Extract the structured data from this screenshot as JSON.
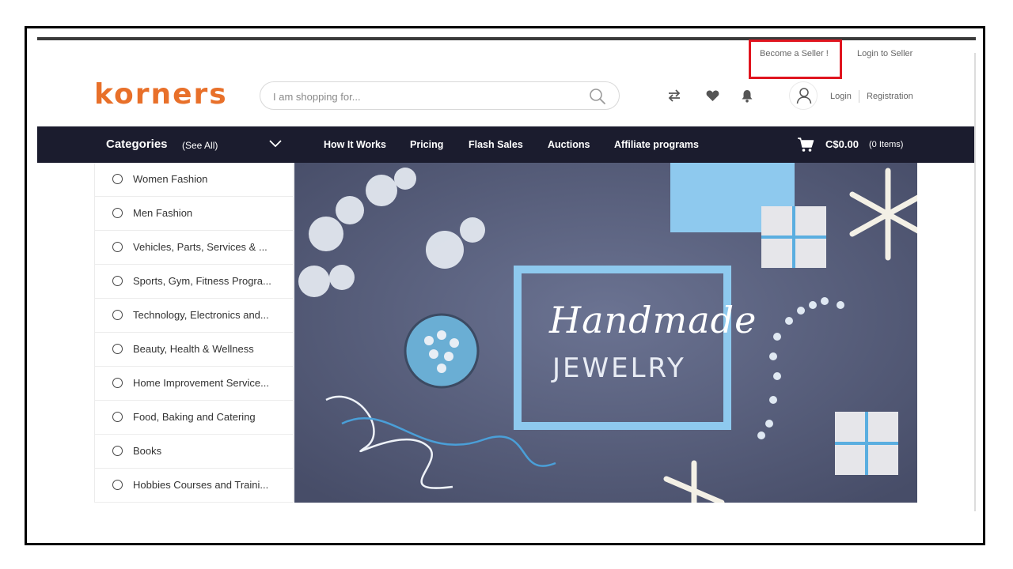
{
  "top_links": {
    "become_seller": "Become a Seller !",
    "login_seller": "Login to Seller"
  },
  "brand": {
    "logo": "korners",
    "accent": "#e8702a"
  },
  "search": {
    "placeholder": "I am shopping for...",
    "icon": "search-icon"
  },
  "header_icons": [
    "compare-icon",
    "heart-icon",
    "bell-icon",
    "user-icon"
  ],
  "auth": {
    "login": "Login",
    "registration": "Registration"
  },
  "nav": {
    "categories_title": "Categories",
    "see_all": "(See All)",
    "items": [
      "How It Works",
      "Pricing",
      "Flash Sales",
      "Auctions",
      "Affiliate programs"
    ],
    "cart_total": "C$0.00",
    "cart_items": "(0 Items)",
    "bg": "#1b1c2e"
  },
  "categories": [
    "Women Fashion",
    "Men Fashion",
    "Vehicles, Parts, Services & ...",
    "Sports, Gym, Fitness Progra...",
    "Technology, Electronics and...",
    "Beauty, Health & Wellness",
    "Home Improvement Service...",
    "Food, Baking and Catering",
    "Books",
    "Hobbies Courses and Traini..."
  ],
  "banner": {
    "line1": "Handmade",
    "line2": "JEWELRY"
  },
  "highlight_color": "#e0151f"
}
